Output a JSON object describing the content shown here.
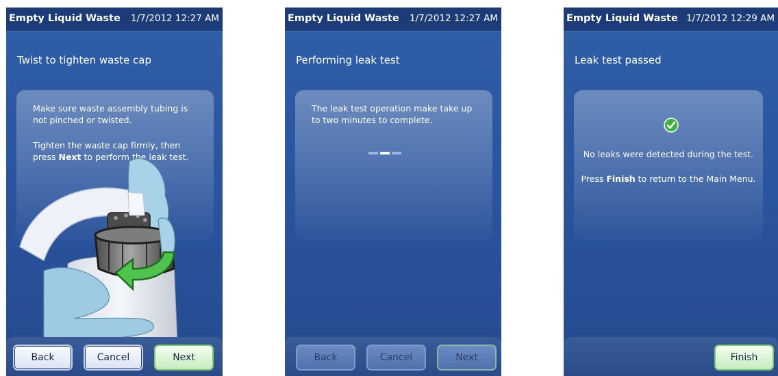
{
  "screens": [
    {
      "title": "Empty Liquid Waste",
      "datetime": "1/7/2012 12:27 AM",
      "heading": "Twist to tighten waste cap",
      "panel_line1": "Make sure waste assembly tubing is not pinched or twisted.",
      "panel_line2_pre": "Tighten the waste cap firmly, then press ",
      "panel_line2_bold": "Next",
      "panel_line2_post": " to perform the leak test.",
      "buttons": {
        "back": "Back",
        "cancel": "Cancel",
        "next": "Next"
      }
    },
    {
      "title": "Empty Liquid Waste",
      "datetime": "1/7/2012 12:27 AM",
      "heading": "Performing leak test",
      "panel_line1": "The leak test operation make take up to two minutes to complete.",
      "buttons": {
        "back": "Back",
        "cancel": "Cancel",
        "next": "Next"
      }
    },
    {
      "title": "Empty Liquid Waste",
      "datetime": "1/7/2012 12:29 AM",
      "heading": "Leak test passed",
      "panel_line1": "No leaks were detected during the test.",
      "panel_line2_pre": "Press ",
      "panel_line2_bold": "Finish",
      "panel_line2_post": " to return to the Main Menu.",
      "buttons": {
        "finish": "Finish"
      }
    }
  ],
  "colors": {
    "screen_bg": "#2b56a0",
    "title_bar": "#1b3c78",
    "next_button_border": "#7ccd68",
    "check_green": "#3cb43c"
  },
  "icons": [
    "curved-arrow-icon",
    "progress-dots-icon",
    "checkmark-icon"
  ]
}
